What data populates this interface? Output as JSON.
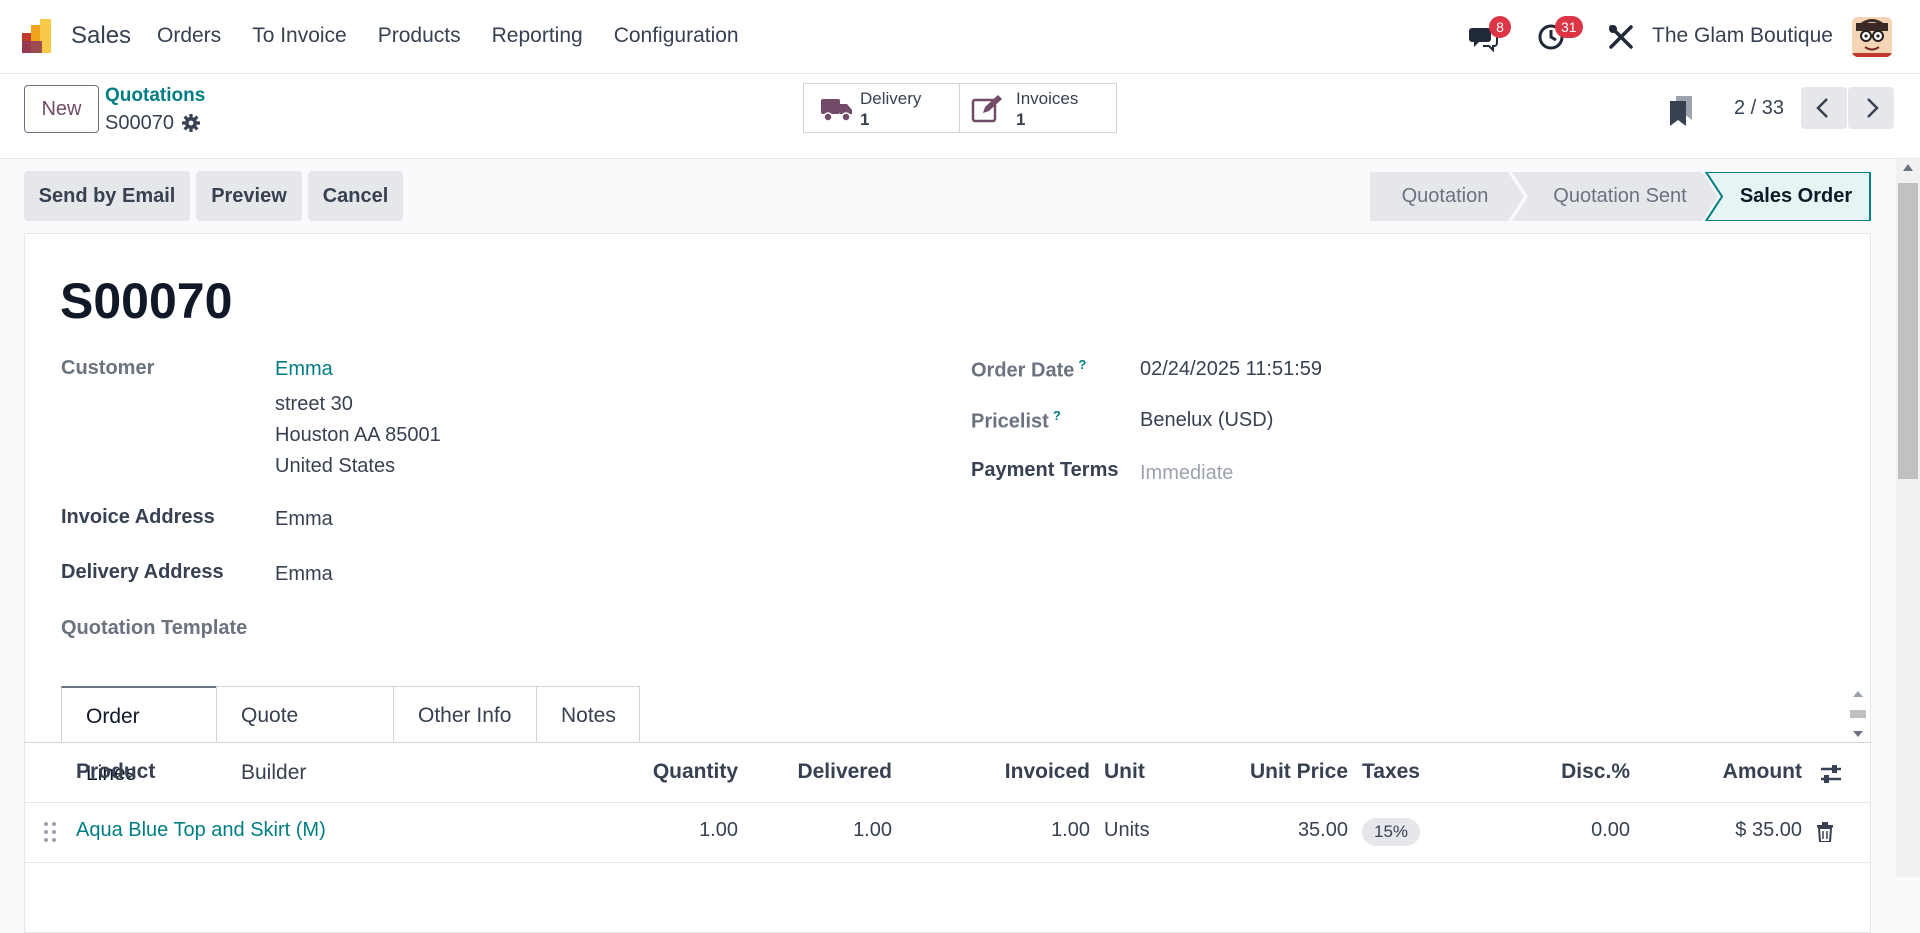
{
  "navbar": {
    "app_name": "Sales",
    "menu": [
      "Orders",
      "To Invoice",
      "Products",
      "Reporting",
      "Configuration"
    ],
    "messages_count": "8",
    "activities_count": "31",
    "company": "The Glam Boutique"
  },
  "control": {
    "new_label": "New",
    "breadcrumb_parent": "Quotations",
    "breadcrumb_current": "S00070",
    "delivery": {
      "label": "Delivery",
      "value": "1"
    },
    "invoices": {
      "label": "Invoices",
      "value": "1"
    },
    "pager": "2 / 33"
  },
  "actions": {
    "send_email": "Send by Email",
    "preview": "Preview",
    "cancel": "Cancel"
  },
  "status_steps": [
    "Quotation",
    "Quotation Sent",
    "Sales Order"
  ],
  "status_active": "Sales Order",
  "form": {
    "title": "S00070",
    "customer_label": "Customer",
    "customer_name": "Emma",
    "customer_street": "street 30",
    "customer_city": "Houston AA 85001",
    "customer_country": "United States",
    "invoice_address_label": "Invoice Address",
    "invoice_address": "Emma",
    "delivery_address_label": "Delivery Address",
    "delivery_address": "Emma",
    "template_label": "Quotation Template",
    "order_date_label": "Order Date",
    "order_date": "02/24/2025 11:51:59",
    "pricelist_label": "Pricelist",
    "pricelist": "Benelux (USD)",
    "payment_terms_label": "Payment Terms",
    "payment_terms_placeholder": "Immediate",
    "help_mark": "?"
  },
  "tabs": [
    "Order Lines",
    "Quote Builder",
    "Other Info",
    "Notes"
  ],
  "table": {
    "headers": {
      "product": "Product",
      "quantity": "Quantity",
      "delivered": "Delivered",
      "invoiced": "Invoiced",
      "unit": "Unit",
      "unit_price": "Unit Price",
      "taxes": "Taxes",
      "disc": "Disc.%",
      "amount": "Amount"
    },
    "rows": [
      {
        "product": "Aqua Blue Top and Skirt (M)",
        "quantity": "1.00",
        "delivered": "1.00",
        "invoiced": "1.00",
        "unit": "Units",
        "unit_price": "35.00",
        "taxes": "15%",
        "disc": "0.00",
        "amount": "$ 35.00"
      }
    ]
  },
  "colors": {
    "brand": "#714B67",
    "link": "#017e84",
    "badge": "#dc3545"
  }
}
